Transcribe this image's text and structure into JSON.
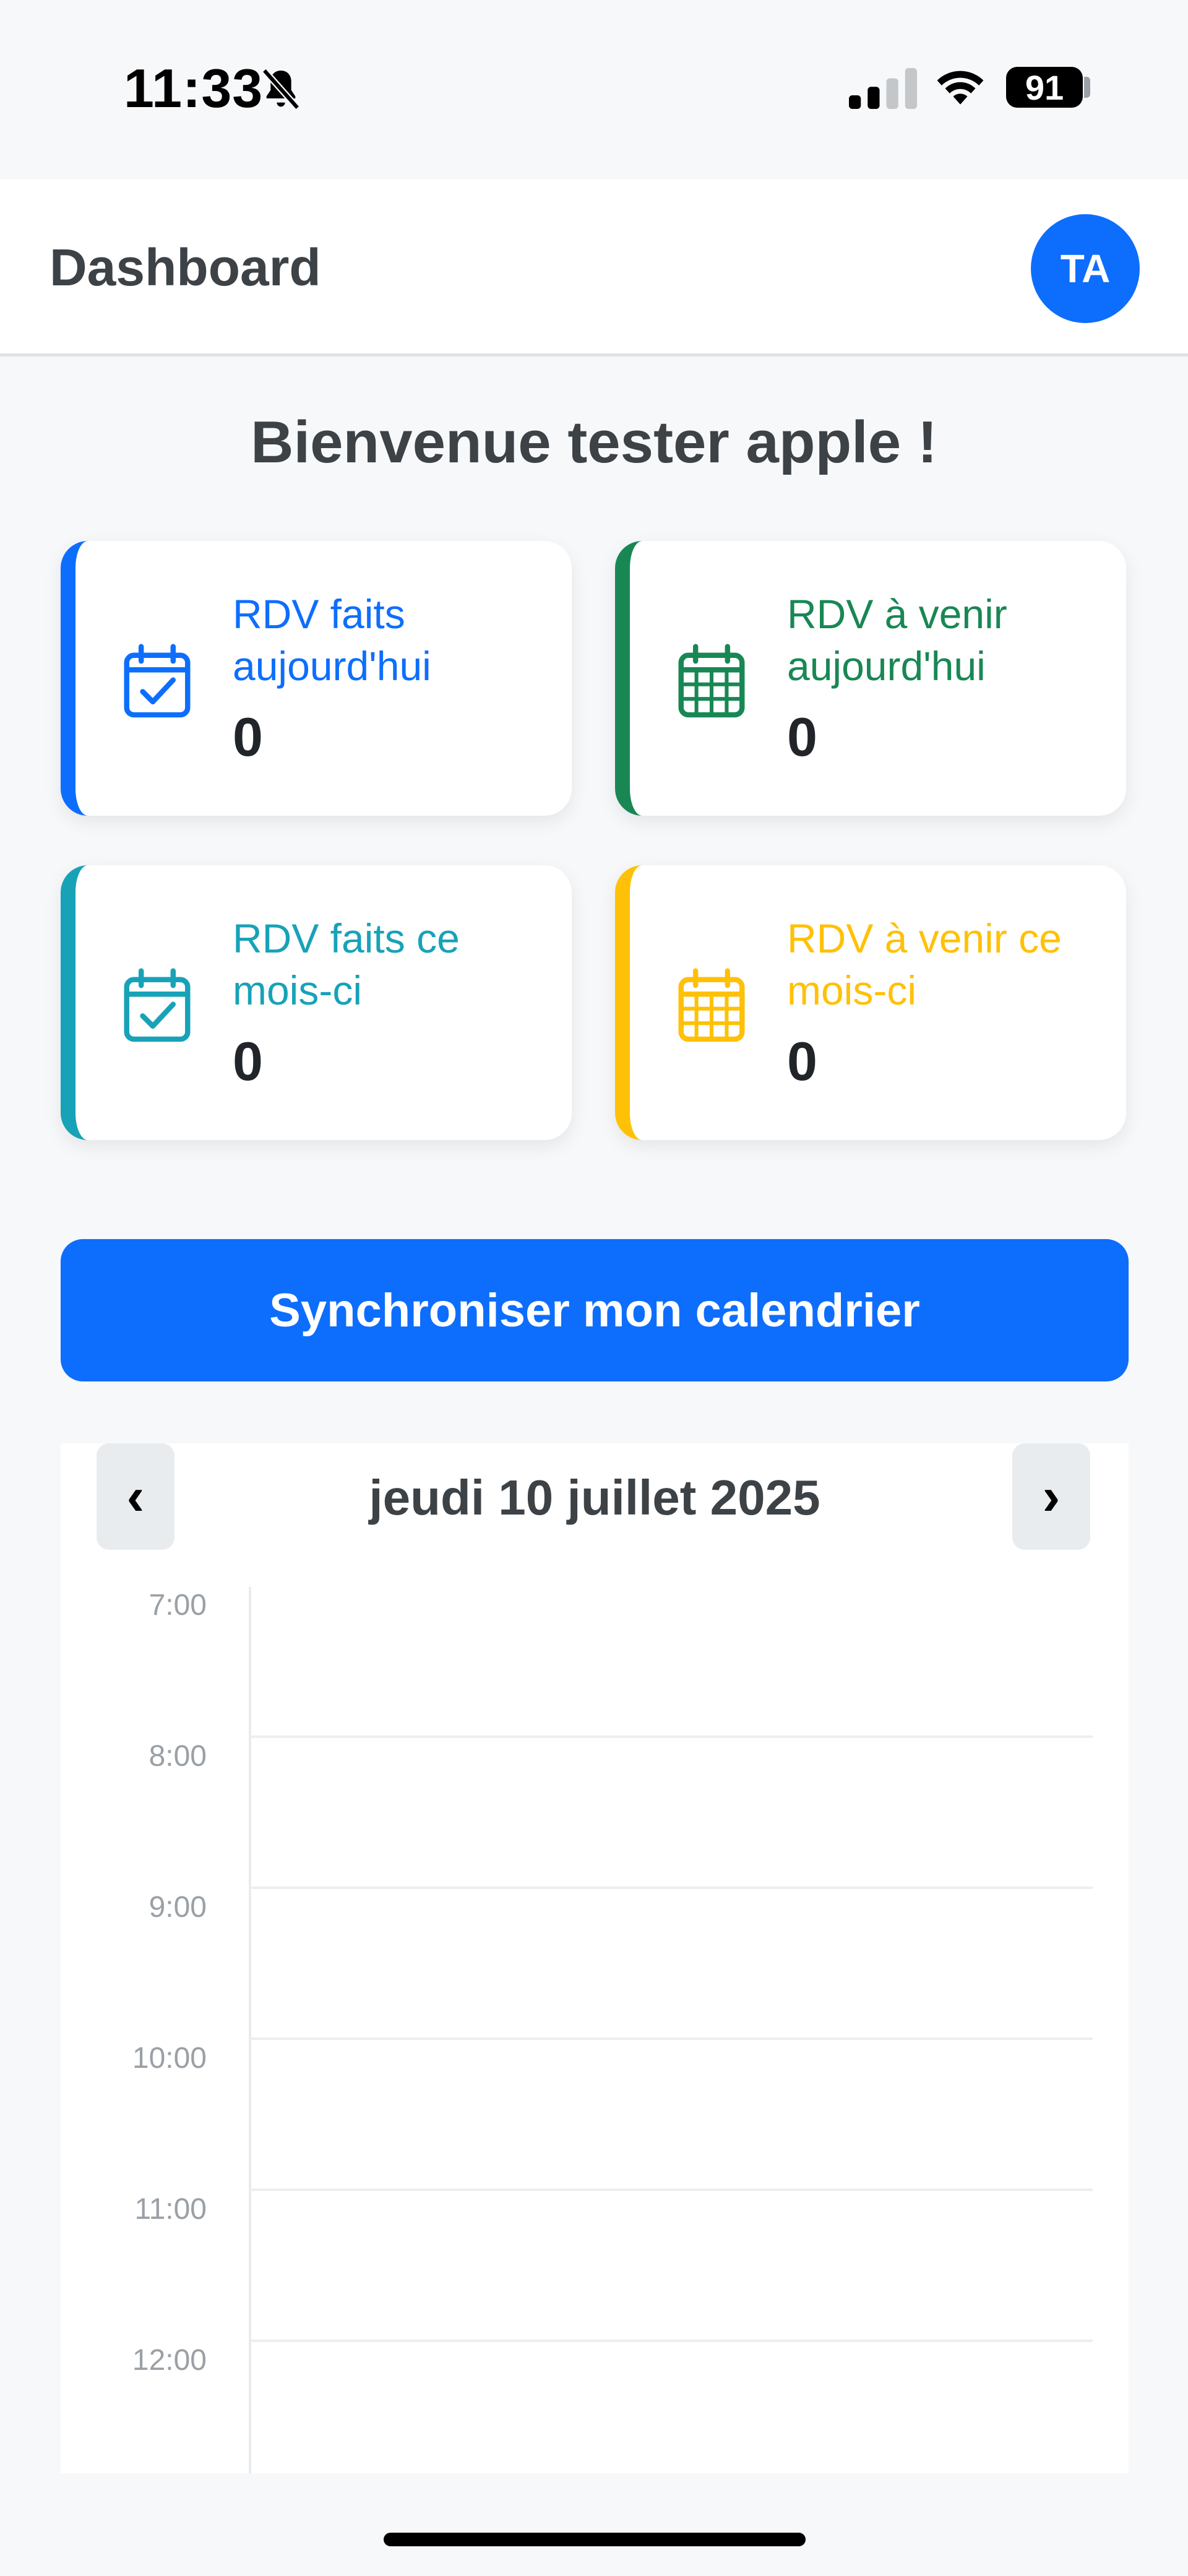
{
  "status_bar": {
    "time": "11:33",
    "battery": "91"
  },
  "header": {
    "title": "Dashboard",
    "avatar_initials": "TA"
  },
  "welcome": "Bienvenue tester apple !",
  "cards": [
    {
      "label": "RDV faits aujourd'hui",
      "value": "0",
      "color": "#0d6efd",
      "icon": "calendar-check-icon"
    },
    {
      "label": "RDV à venir aujourd'hui",
      "value": "0",
      "color": "#198754",
      "icon": "calendar-grid-icon"
    },
    {
      "label": "RDV faits ce mois-ci",
      "value": "0",
      "color": "#17a2b8",
      "icon": "calendar-check-icon"
    },
    {
      "label": "RDV à venir ce mois-ci",
      "value": "0",
      "color": "#ffc107",
      "icon": "calendar-grid-icon"
    }
  ],
  "sync_button": "Synchroniser mon calendrier",
  "calendar": {
    "prev": "‹",
    "next": "›",
    "date": "jeudi 10 juillet 2025",
    "hours": [
      "7:00",
      "8:00",
      "9:00",
      "10:00",
      "11:00",
      "12:00"
    ]
  },
  "colors": {
    "primary": "#0d6efd",
    "success": "#198754",
    "info": "#17a2b8",
    "warning": "#ffc107"
  }
}
